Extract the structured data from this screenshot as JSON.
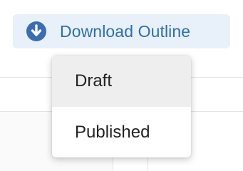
{
  "download_button": {
    "label": "Download Outline",
    "icon": "arrow-down-circle-icon",
    "background_color": "#e8f1fa",
    "accent_color": "#2e6eaf"
  },
  "menu": {
    "items": [
      {
        "label": "Draft",
        "highlighted": true
      },
      {
        "label": "Published",
        "highlighted": false
      }
    ],
    "highlight_color": "#eeeeee"
  }
}
